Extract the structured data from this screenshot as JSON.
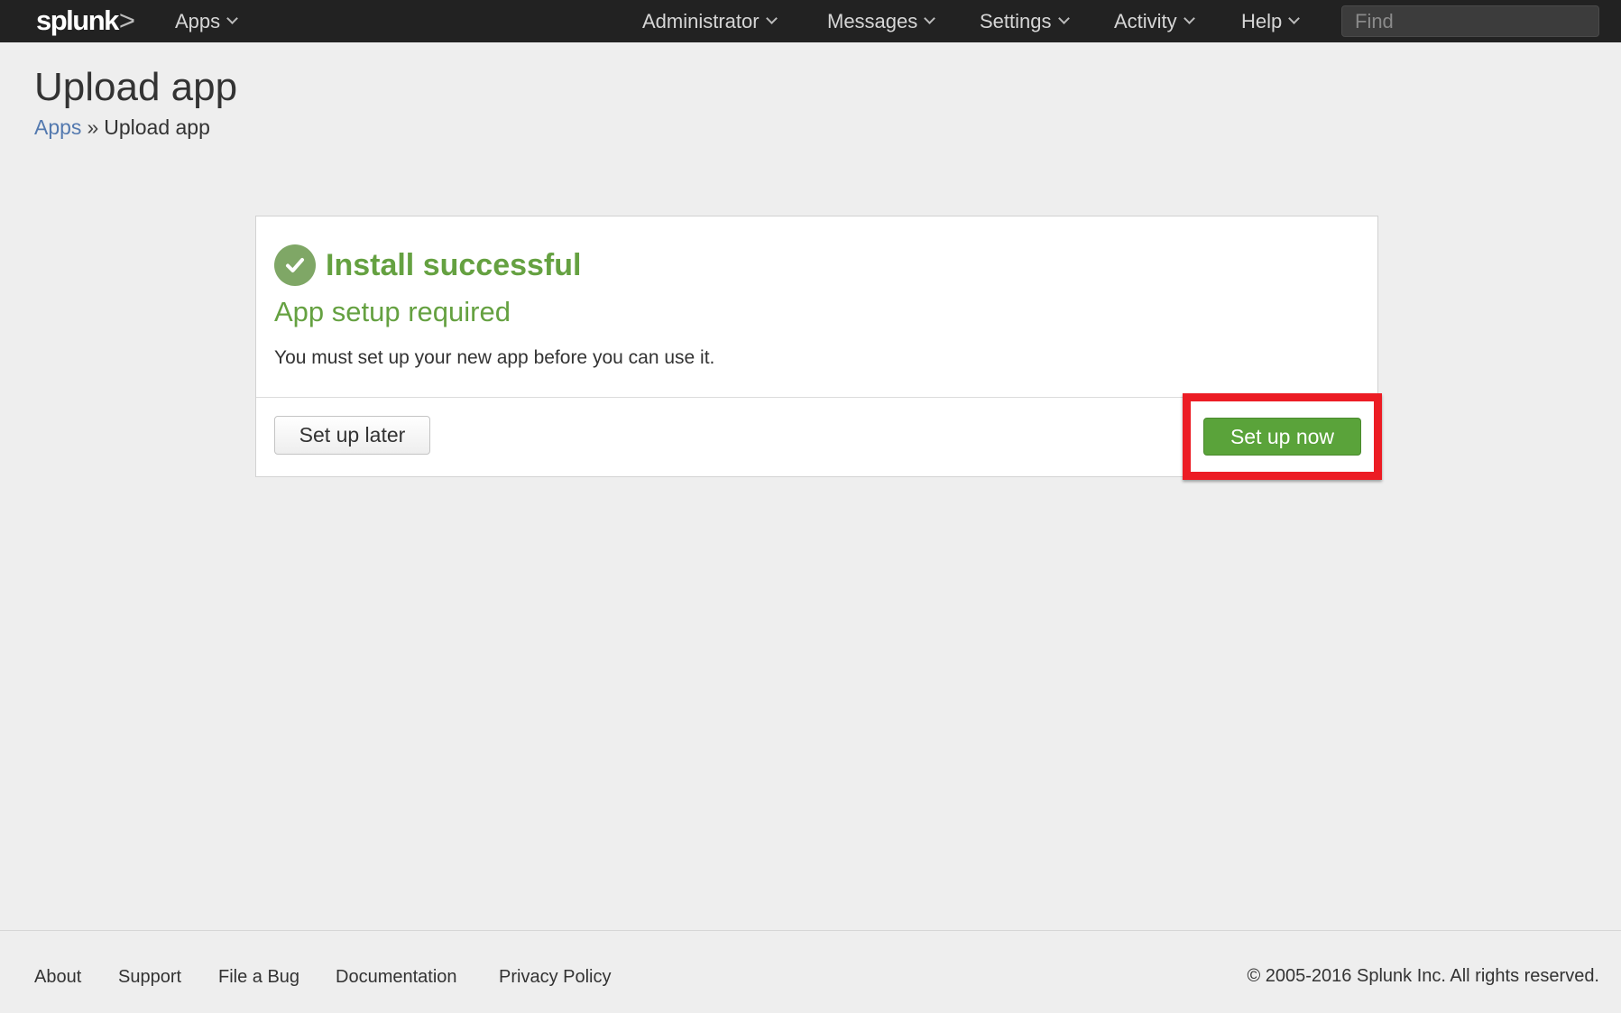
{
  "topbar": {
    "logo_text": "splunk",
    "logo_suffix": ">",
    "nav": {
      "apps": "Apps",
      "administrator": "Administrator",
      "messages": "Messages",
      "settings": "Settings",
      "activity": "Activity",
      "help": "Help"
    },
    "find_placeholder": "Find"
  },
  "page": {
    "title": "Upload app",
    "breadcrumb": {
      "parent": "Apps",
      "separator": "»",
      "current": "Upload app"
    }
  },
  "card": {
    "icon": "checkmark-icon",
    "heading": "Install successful",
    "subheading": "App setup required",
    "message": "You must set up your new app before you can use it.",
    "later_button": "Set up later",
    "now_button": "Set up now"
  },
  "footer": {
    "links": {
      "about": "About",
      "support": "Support",
      "bug": "File a Bug",
      "documentation": "Documentation",
      "privacy": "Privacy Policy"
    },
    "copyright": "© 2005-2016 Splunk Inc. All rights reserved."
  },
  "colors": {
    "topbar": "#222222",
    "success_green": "#65a141",
    "button_green": "#5aa33a",
    "link_blue": "#5379af",
    "highlight_red": "#ec1c24"
  }
}
